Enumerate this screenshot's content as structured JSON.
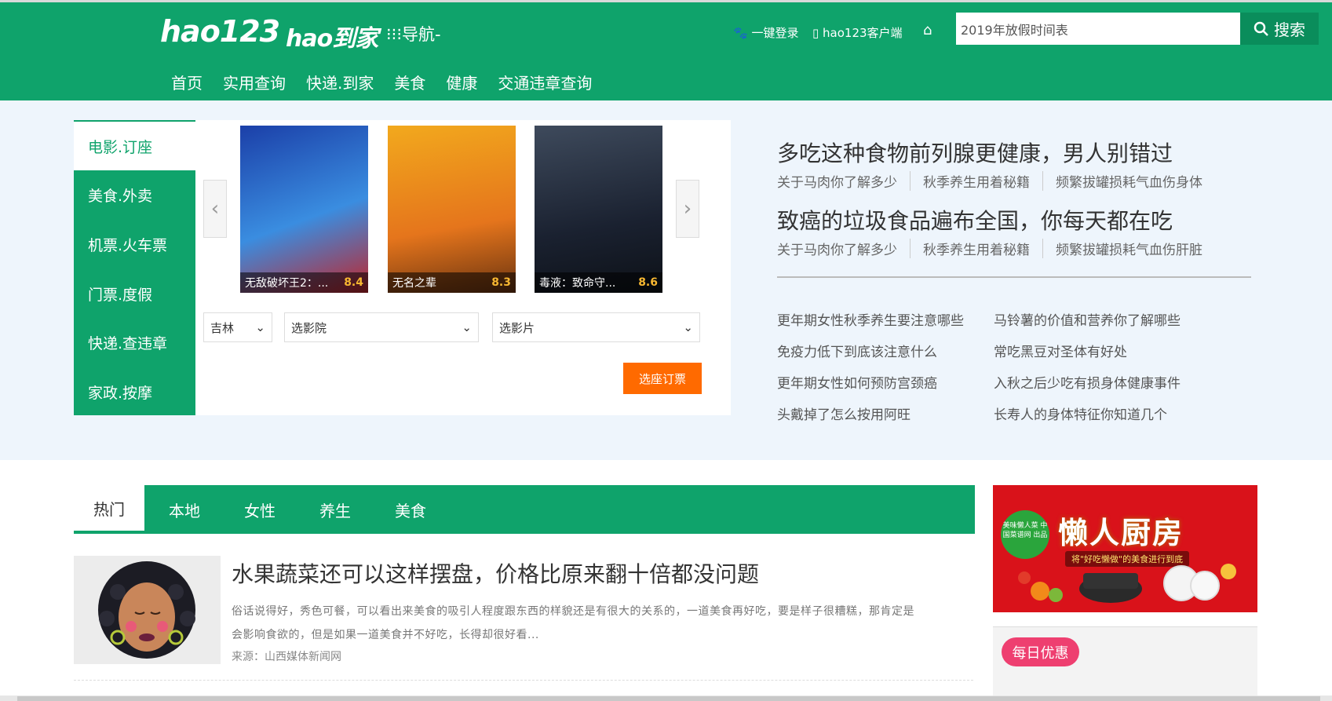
{
  "header": {
    "logo_main": "hao123",
    "logo_sub": "hao到家",
    "nav_label": "⁝⁝⁝导航-",
    "login": "一键登录",
    "client": "hao123客户端",
    "search_value": "2019年放假时间表",
    "search_button": "搜索",
    "menu": [
      "首页",
      "实用查询",
      "快递.到家",
      "美食",
      "健康",
      "交通违章查询"
    ]
  },
  "ticket": {
    "categories": [
      "电影.订座",
      "美食.外卖",
      "机票.火车票",
      "门票.度假",
      "快递.查违章",
      "家政.按摩"
    ],
    "movies": [
      {
        "title": "无敌破坏王2：...",
        "score": "8.4"
      },
      {
        "title": "无名之辈",
        "score": "8.3"
      },
      {
        "title": "毒液：致命守...",
        "score": "8.6"
      }
    ],
    "city": "吉林",
    "cinema_placeholder": "选影院",
    "film_placeholder": "选影片",
    "book_button": "选座订票"
  },
  "health": {
    "headlines": [
      {
        "title": "多吃这种食物前列腺更健康，男人别错过",
        "subs": [
          "关于马肉你了解多少",
          "秋季养生用着秘籍",
          "频繁拔罐损耗气血伤身体"
        ]
      },
      {
        "title": "致癌的垃圾食品遍布全国，你每天都在吃",
        "subs": [
          "关于马肉你了解多少",
          "秋季养生用着秘籍",
          "频繁拔罐损耗气血伤肝脏"
        ]
      }
    ],
    "links_left": [
      "更年期女性秋季养生要注意哪些",
      "免疫力低下到底该注意什么",
      "更年期女性如何预防宫颈癌",
      "头戴掉了怎么按用阿旺"
    ],
    "links_right": [
      "马铃薯的价值和营养你了解哪些",
      "常吃黑豆对圣体有好处",
      "入秋之后少吃有损身体健康事件",
      "长寿人的身体特征你知道几个"
    ]
  },
  "feed": {
    "tabs": [
      "热门",
      "本地",
      "女性",
      "养生",
      "美食"
    ],
    "article": {
      "title": "水果蔬菜还可以这样摆盘，价格比原来翻十倍都没问题",
      "summary": "俗话说得好，秀色可餐，可以看出来美食的吸引人程度跟东西的样貌还是有很大的关系的，一道美食再好吃，要是样子很糟糕，那肯定是会影响食欲的，但是如果一道美食并不好吃，长得却很好看...",
      "source": "来源：山西媒体新闻网"
    }
  },
  "sidebar": {
    "ad_title": "懒人厨房",
    "ad_sub": "将\"好吃懒做\"的美食进行到底",
    "ad_badge": "美味懒人菜 中国菜谱网 出品",
    "daily": "每日优惠"
  },
  "colors": {
    "brand": "#0fa36b",
    "accent": "#ff6a00",
    "pink": "#ee3f70"
  }
}
